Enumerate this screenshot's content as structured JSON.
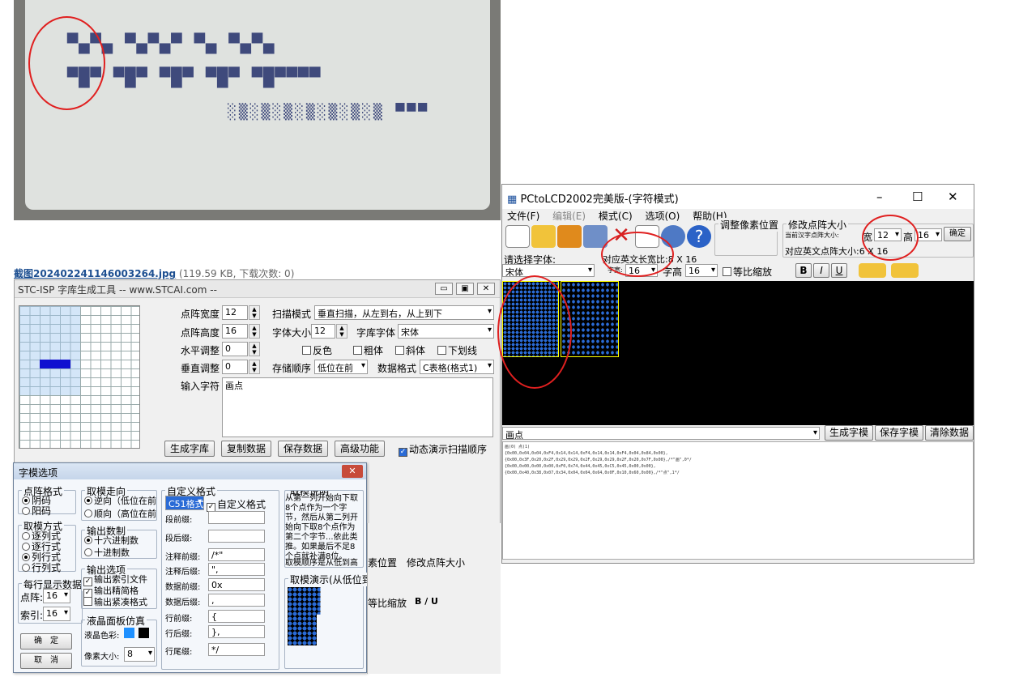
{
  "lcd": {
    "glyph_rows": [
      "▀▄▀▄ ▀▄▀▄▀ ▀▄ ▀▄▀▄",
      "▀█▀ ▀█▀ ▀█▀ ▀█▀ ▀█▀▀▀▀"
    ]
  },
  "caption": {
    "link": "截图20240224114600326​4.jpg",
    "meta": "(119.59 KB, 下载次数: 0)"
  },
  "stc": {
    "title": "STC-ISP 字库生成工具 -- www.STCAI.com --",
    "dot_width_label": "点阵宽度",
    "dot_width": "12",
    "dot_height_label": "点阵高度",
    "dot_height": "16",
    "h_adjust_label": "水平调整",
    "h_adjust": "0",
    "v_adjust_label": "垂直调整",
    "v_adjust": "0",
    "input_label": "输入字符",
    "input_value": "画点",
    "scan_label": "扫描模式",
    "scan_value": "垂直扫描，从左到右，从上到下",
    "fontsize_label": "字体大小",
    "fontsize": "12",
    "font_label": "字库字体",
    "font": "宋体",
    "cb_invert": "反色",
    "cb_bold": "粗体",
    "cb_italic": "斜体",
    "cb_underline": "下划线",
    "order_label": "存储顺序",
    "order_value": "低位在前",
    "format_label": "数据格式",
    "format_value": "C表格(格式1)",
    "btn_gen": "生成字库",
    "btn_copy": "复制数据",
    "btn_save": "保存数据",
    "btn_adv": "高级功能",
    "cb_anim": "动态演示扫描顺序"
  },
  "dlg": {
    "title": "字模选项",
    "g1": "点阵格式",
    "g1a": "阴码",
    "g1b": "阳码",
    "g2": "取模方式",
    "g2a": "逐列式",
    "g2b": "逐行式",
    "g2c": "列行式",
    "g2d": "行列式",
    "g3": "每行显示数据",
    "g3a": "点阵:",
    "g3av": "16",
    "g3b": "索引:",
    "g3bv": "16",
    "ok": "确　定",
    "cancel": "取　消",
    "g4": "取模走向",
    "g4a": "逆向（低位在前",
    "g4b": "顺向（高位在前",
    "g5": "输出数制",
    "g5a": "十六进制数",
    "g5b": "十进制数",
    "g6": "输出选项",
    "g6a": "输出索引文件",
    "g6b": "输出精简格",
    "g6c": "输出紧凑格式",
    "g7": "液晶面板仿真",
    "g7a": "液晶色彩:",
    "g7b": "像素大小:",
    "g7bv": "8",
    "g8": "自定义格式",
    "g8sel": "C51格式",
    "g8cb": "自定义格式",
    "f1": "段前缀:",
    "f1v": "",
    "f2": "段后缀:",
    "f2v": "",
    "f3": "注释前缀:",
    "f3v": "/*\"",
    "f4": "注释后缀:",
    "f4v": "\",",
    "f5": "数据前缀:",
    "f5v": "0x",
    "f6": "数据后缀:",
    "f6v": ",",
    "f7": "行前缀:",
    "f7v": "{",
    "f8": "行后缀:",
    "f8v": "},",
    "f9": "行尾缀:",
    "f9v": "*/",
    "g9": "取模说明",
    "g9t": "从第一列开始向下取8个点作为一个字节，然后从第二列开始向下取8个点作为第二个字节...依此类推。如果最后不足8个点就补满8位。",
    "g9t2": "取模顺序是从低到高",
    "g10": "取模演示(从低位到"
  },
  "pc": {
    "title": "PCtoLCD2002完美版-(字符模式)",
    "menu": [
      "文件(F)",
      "编辑(E)",
      "模式(C)",
      "选项(O)",
      "帮助(H)"
    ],
    "adjust_pos": "调整像素位置",
    "resize": "修改点阵大小",
    "cur_size": "当前汉字点阵大小:",
    "w_label": "宽",
    "w_val": "12",
    "h_label": "高",
    "h_val": "16",
    "ok_label": "确定",
    "en_size": "对应英文点阵大小:6 X 16",
    "pick_font": "请选择字体:",
    "font_val": "宋体",
    "en_w": "对应英文长宽比:8 X 16",
    "zw_label": "字宽:",
    "zw_val": "16",
    "zh_label": "字高",
    "zh_val": "16",
    "ratio": "等比缩放",
    "b": "B",
    "i": "I",
    "u": "U",
    "text_in": "画点",
    "btn_gen": "生成字模",
    "btn_save": "保存字模",
    "btn_clear": "清除数据",
    "out": [
      "画(0) 点(1)",
      "{0x00,0x04,0x04,0xF4,0x14,0x14,0xF4,0x14,0x14,0xF4,0x04,0x84,0x00},",
      "{0x00,0x3F,0x20,0x2F,0x29,0x29,0x2F,0x29,0x29,0x2F,0x20,0x7F,0x00},/*\"画\",0*/",
      "{0x00,0x00,0x00,0x00,0xF0,0x74,0x44,0x45,0xC5,0x45,0x00,0x00},",
      "{0x00,0x40,0x38,0x07,0x34,0x04,0x04,0x64,0x0F,0x10,0x60,0x00},/*\"点\",1*/"
    ]
  }
}
